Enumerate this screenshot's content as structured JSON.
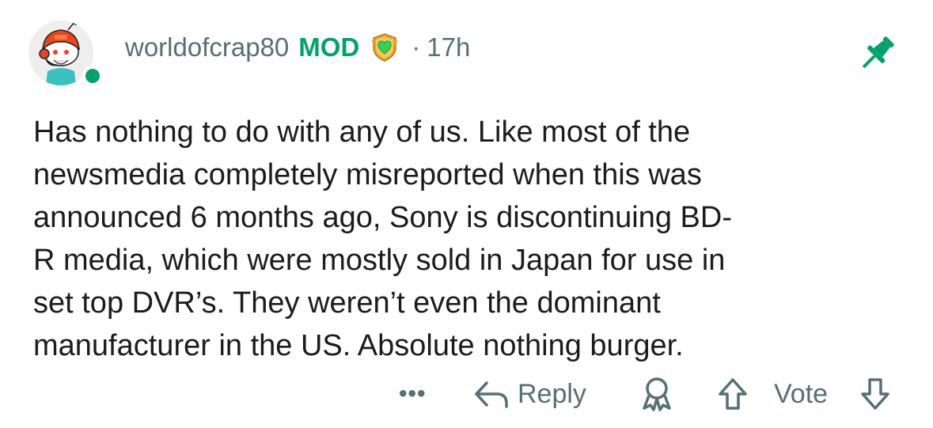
{
  "comment": {
    "username": "worldofcrap80",
    "mod_label": "MOD",
    "separator": "·",
    "timestamp": "17h",
    "body_lines": [
      "Has nothing to do with any of us. Like most of the",
      "newsmedia completely misreported when this was",
      "announced 6 months ago, Sony is discontinuing BD-",
      "R media, which were mostly sold in Japan for use in",
      "set top DVR’s. They weren’t even the dominant",
      "manufacturer in the US. Absolute nothing burger."
    ]
  },
  "actions": {
    "more": "•••",
    "reply": "Reply",
    "vote": "Vote"
  },
  "icons": {
    "avatar": "reddit-snoo-avatar",
    "mod_shield": "mod-shield-heart-icon",
    "pin": "pin-icon",
    "reply": "reply-arrow-icon",
    "award": "award-icon",
    "upvote": "upvote-arrow-icon",
    "downvote": "downvote-arrow-icon"
  },
  "colors": {
    "mod_green": "#01a368",
    "meta_gray": "#576f76",
    "text": "#1c1c1c",
    "online": "#01a368",
    "pin": "#01a368"
  }
}
